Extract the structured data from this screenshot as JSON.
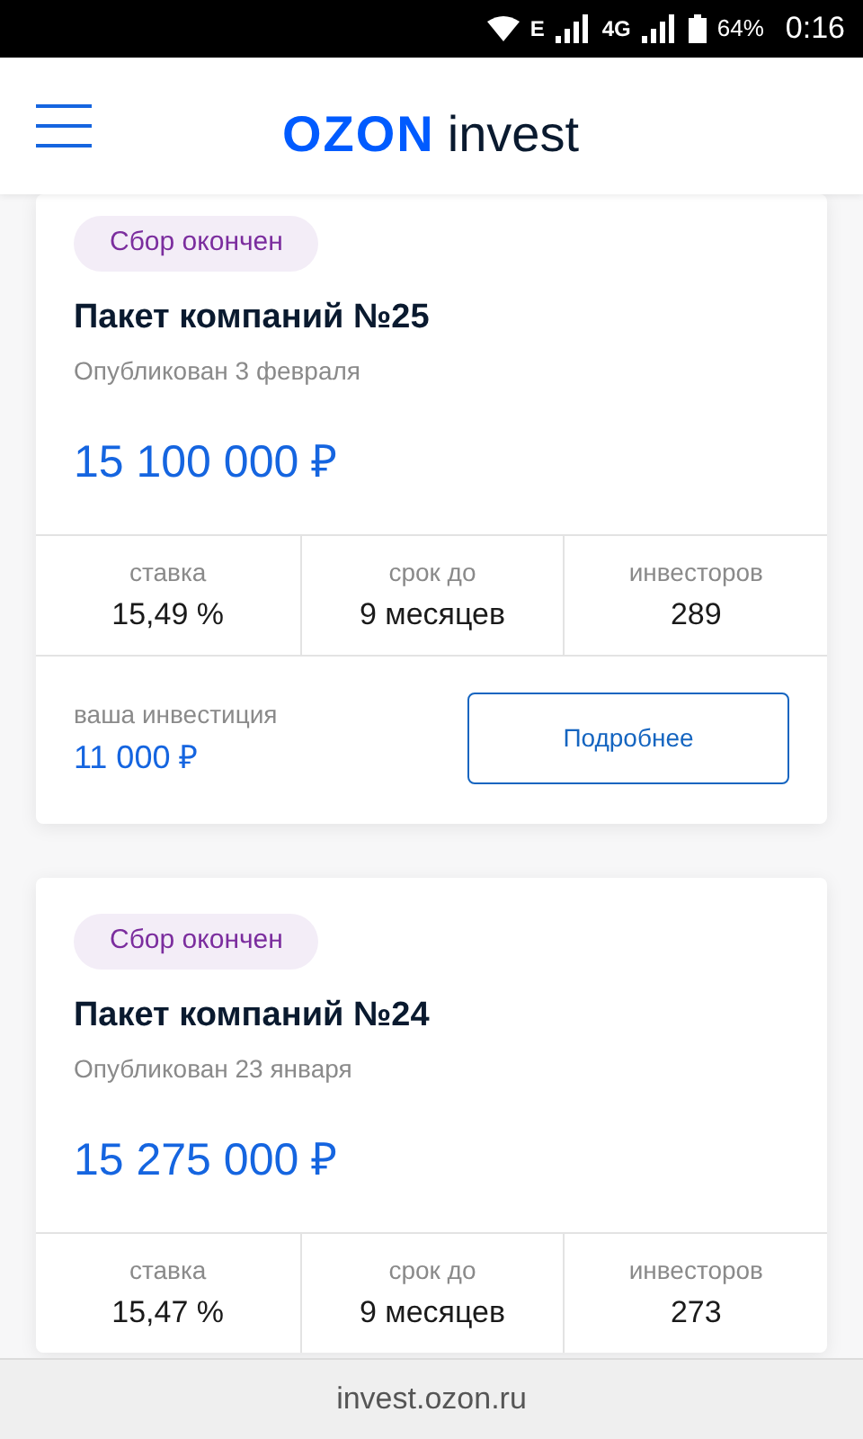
{
  "status_bar": {
    "network_1": "E",
    "network_2": "4G",
    "battery": "64%",
    "time": "0:16"
  },
  "header": {
    "logo_brand": "OZON",
    "logo_suffix": "invest"
  },
  "cards": [
    {
      "badge": "Сбор окончен",
      "title": "Пакет компаний №25",
      "published": "Опубликован 3 февраля",
      "amount": "15 100 000 ₽",
      "stats": [
        {
          "label": "ставка",
          "value": "15,49 %"
        },
        {
          "label": "срок до",
          "value": "9 месяцев"
        },
        {
          "label": "инвесторов",
          "value": "289"
        }
      ],
      "investment": {
        "label": "ваша инвестиция",
        "value": "11 000 ₽",
        "button": "Подробнее"
      }
    },
    {
      "badge": "Сбор окончен",
      "title": "Пакет компаний №24",
      "published": "Опубликован 23 января",
      "amount": "15 275 000 ₽",
      "stats": [
        {
          "label": "ставка",
          "value": "15,47 %"
        },
        {
          "label": "срок до",
          "value": "9 месяцев"
        },
        {
          "label": "инвесторов",
          "value": "273"
        }
      ]
    }
  ],
  "footer": {
    "url": "invest.ozon.ru"
  }
}
